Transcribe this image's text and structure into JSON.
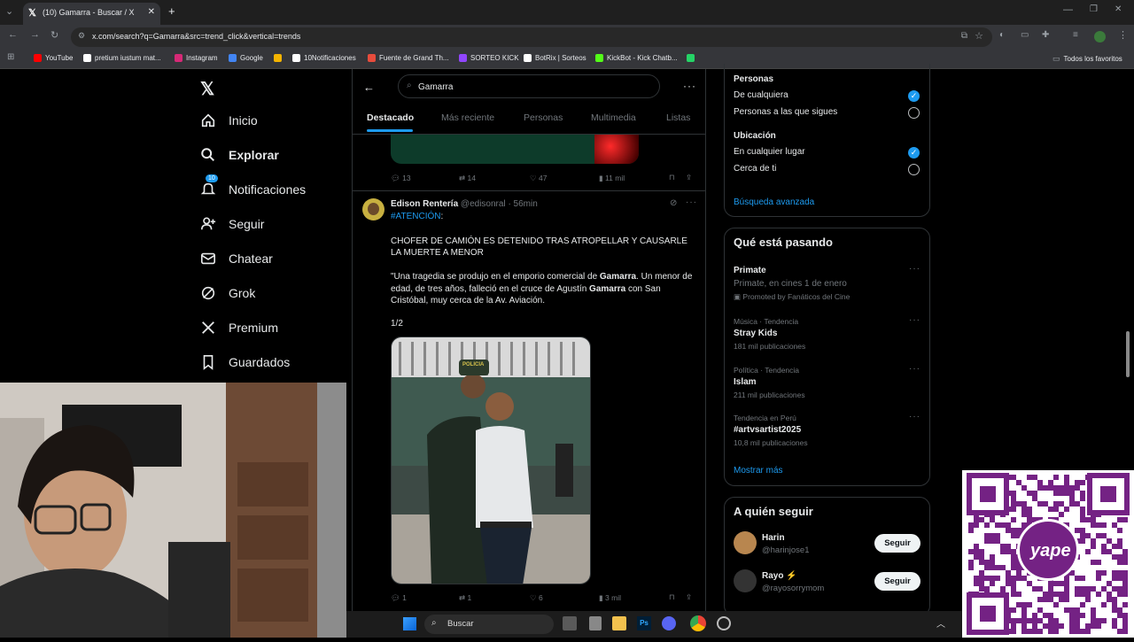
{
  "browser": {
    "tab_title": "(10) Gamarra - Buscar / X",
    "url": "x.com/search?q=Gamarra&src=trend_click&vertical=trends",
    "bookmarks": [
      {
        "label": "YouTube",
        "color": "#ff0000"
      },
      {
        "label": "pretium iustum mat...",
        "color": "#ffffff"
      },
      {
        "label": "Instagram",
        "color": "#d62976"
      },
      {
        "label": "Google",
        "color": "#4285f4"
      },
      {
        "label": "",
        "color": "#f4b400"
      },
      {
        "label": "10Notificaciones",
        "color": "#ffffff"
      },
      {
        "label": "Fuente de Grand Th...",
        "color": "#e74c3c"
      },
      {
        "label": "SORTEO KICK",
        "color": "#9146ff"
      },
      {
        "label": "BotRix | Sorteos",
        "color": "#ffffff"
      },
      {
        "label": "KickBot - Kick Chatb...",
        "color": "#53fc18"
      },
      {
        "label": "",
        "color": "#25d366"
      }
    ],
    "all_favorites": "Todos los favoritos"
  },
  "nav": {
    "items": [
      {
        "label": "Inicio",
        "icon": "home-icon"
      },
      {
        "label": "Explorar",
        "icon": "search-icon"
      },
      {
        "label": "Notificaciones",
        "icon": "bell-icon",
        "badge": "10"
      },
      {
        "label": "Seguir",
        "icon": "follow-icon"
      },
      {
        "label": "Chatear",
        "icon": "mail-icon"
      },
      {
        "label": "Grok",
        "icon": "grok-icon"
      },
      {
        "label": "Premium",
        "icon": "x-icon"
      },
      {
        "label": "Guardados",
        "icon": "bookmark-icon"
      }
    ]
  },
  "search": {
    "query": "Gamarra",
    "tabs": [
      "Destacado",
      "Más reciente",
      "Personas",
      "Multimedia",
      "Listas"
    ]
  },
  "prev_tweet_actions": {
    "replies": "13",
    "retweets": "14",
    "likes": "47",
    "views": "11 mil"
  },
  "tweet": {
    "name": "Edison Rentería",
    "handle": "@edisonral",
    "time": "56min",
    "hashtag": "#ATENCIÓN",
    "headline": "CHOFER DE CAMIÓN ES DETENIDO TRAS ATROPELLAR Y CAUSARLE LA MUERTE A MENOR",
    "body_parts": [
      "\"Una tragedia se produjo en el emporio comercial de ",
      "Gamarra",
      ". Un menor de edad, de tres años, falleció en el cruce de Agustín ",
      "Gamarra",
      " con San Cristóbal, muy cerca de la Av. Aviación."
    ],
    "counter": "1/2",
    "image_label": "POLICIA",
    "actions": {
      "replies": "1",
      "retweets": "1",
      "likes": "6",
      "views": "3 mil"
    }
  },
  "filters": {
    "people_title": "Personas",
    "people_options": [
      {
        "label": "De cualquiera",
        "checked": true
      },
      {
        "label": "Personas a las que sigues",
        "checked": false
      }
    ],
    "location_title": "Ubicación",
    "location_options": [
      {
        "label": "En cualquier lugar",
        "checked": true
      },
      {
        "label": "Cerca de ti",
        "checked": false
      }
    ],
    "advanced": "Búsqueda avanzada"
  },
  "trending": {
    "title": "Qué está pasando",
    "promoted": {
      "title": "Primate",
      "subtitle": "Primate, en cines 1 de enero",
      "promo": "Promoted by Fanáticos del Cine"
    },
    "items": [
      {
        "context": "Música · Tendencia",
        "name": "Stray Kids",
        "count": "181 mil publicaciones"
      },
      {
        "context": "Política · Tendencia",
        "name": "Islam",
        "count": "211 mil publicaciones"
      },
      {
        "context": "Tendencia en Perú",
        "name": "#artvsartist2025",
        "count": "10,8 mil publicaciones"
      }
    ],
    "show_more": "Mostrar más"
  },
  "who_to_follow": {
    "title": "A quién seguir",
    "users": [
      {
        "name": "Harin",
        "handle": "@harinjose1",
        "button": "Seguir"
      },
      {
        "name": "Rayo ⚡",
        "handle": "@rayosorrymom",
        "button": "Seguir"
      }
    ]
  },
  "taskbar": {
    "search_placeholder": "Buscar"
  },
  "qr": {
    "brand": "yape"
  },
  "colors": {
    "accent": "#1d9bf0",
    "background": "#000000",
    "border": "#2f3336",
    "muted": "#71767b",
    "yape": "#742284"
  }
}
